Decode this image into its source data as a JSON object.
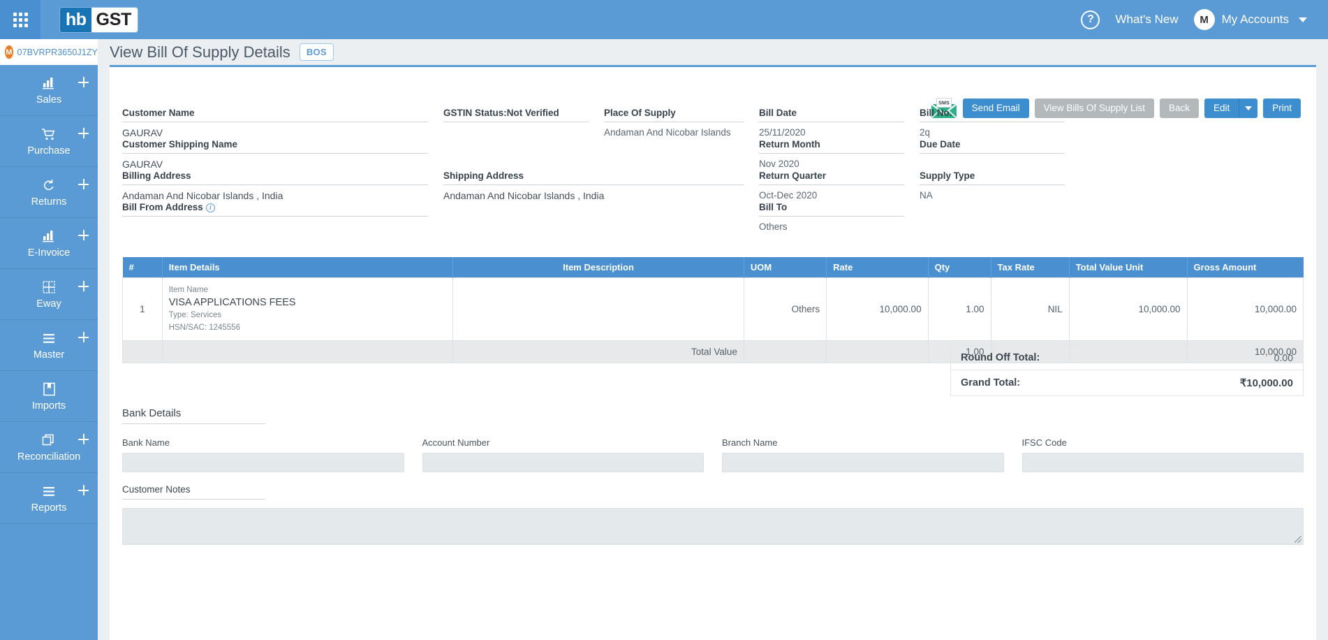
{
  "topbar": {
    "apps_icon": "apps-grid-icon",
    "logo_left": "hb",
    "logo_right": "GST",
    "help_icon": "?",
    "whats_new": "What's New",
    "avatar_initial": "M",
    "account_name": "My Accounts"
  },
  "sidebar": {
    "gstin": "07BVRPR3650J1ZY",
    "gstin_avatar": "M",
    "items": [
      {
        "label": "Sales",
        "icon": "bar-chart-icon"
      },
      {
        "label": "Purchase",
        "icon": "shopping-cart-icon"
      },
      {
        "label": "Returns",
        "icon": "refresh-cycle-icon"
      },
      {
        "label": "E-Invoice",
        "icon": "bar-chart-icon"
      },
      {
        "label": "Eway",
        "icon": "grid-dashed-icon"
      },
      {
        "label": "Master",
        "icon": "hamburger-icon"
      },
      {
        "label": "Imports",
        "icon": "bookmark-book-icon"
      },
      {
        "label": "Reconciliation",
        "icon": "copy-layers-icon"
      },
      {
        "label": "Reports",
        "icon": "hamburger-icon"
      }
    ]
  },
  "page": {
    "title": "View Bill Of Supply Details",
    "badge": "BOS"
  },
  "actions": {
    "sms_icon_label": "SMS",
    "send_email": "Send Email",
    "view_list": "View Bills Of Supply List",
    "back": "Back",
    "edit": "Edit",
    "print": "Print"
  },
  "details": {
    "customer_name_label": "Customer Name",
    "customer_name_value": "GAURAV",
    "customer_shipping_name_label": "Customer Shipping Name",
    "customer_shipping_name_value": "GAURAV",
    "billing_address_label": "Billing Address",
    "billing_address_value": "Andaman And Nicobar Islands , India",
    "bill_from_address_label": "Bill From Address",
    "gstin_status_label": "GSTIN Status:Not Verified",
    "shipping_address_label": "Shipping Address",
    "shipping_address_value": "Andaman And Nicobar Islands , India",
    "place_of_supply_label": "Place Of Supply",
    "place_of_supply_value": "Andaman And Nicobar Islands",
    "bill_date_label": "Bill Date",
    "bill_date_value": "25/11/2020",
    "return_month_label": "Return Month",
    "return_month_value": "Nov 2020",
    "return_quarter_label": "Return Quarter",
    "return_quarter_value": "Oct-Dec 2020",
    "bill_to_label": "Bill To",
    "bill_to_value": "Others",
    "bill_no_label": "Bill No.",
    "bill_no_value": "2q",
    "due_date_label": "Due Date",
    "due_date_value": "",
    "supply_type_label": "Supply Type",
    "supply_type_value": "NA"
  },
  "items_table": {
    "headers": [
      "#",
      "Item Details",
      "Item Description",
      "UOM",
      "Rate",
      "Qty",
      "Tax Rate",
      "Total Value Unit",
      "Gross Amount"
    ],
    "rows": [
      {
        "num": "1",
        "item_name_label": "Item Name",
        "item_name": "VISA APPLICATIONS FEES",
        "type": "Type: Services",
        "hsn": "HSN/SAC: 1245556",
        "description": "",
        "uom": "Others",
        "rate": "10,000.00",
        "qty": "1.00",
        "tax_rate": "NIL",
        "total_value_unit": "10,000.00",
        "gross_amount": "10,000.00"
      }
    ],
    "total_row": {
      "label": "Total Value",
      "qty": "1.00",
      "gross_amount": "10,000.00"
    }
  },
  "totals": {
    "round_off_label": "Round Off Total:",
    "round_off_value": "0.00",
    "grand_total_label": "Grand Total:",
    "grand_total_value": "₹10,000.00"
  },
  "bank": {
    "section_title": "Bank Details",
    "bank_name_label": "Bank Name",
    "bank_name_value": "",
    "account_number_label": "Account Number",
    "account_number_value": "",
    "branch_name_label": "Branch Name",
    "branch_name_value": "",
    "ifsc_label": "IFSC Code",
    "ifsc_value": ""
  },
  "notes": {
    "label": "Customer Notes",
    "value": ""
  },
  "colors": {
    "brand_blue": "#5b9bd5",
    "header_blue": "#4a90d0",
    "accent_orange": "#ec7c26",
    "sms_green": "#2bb08a",
    "muted_grey": "#b3b8bb"
  }
}
